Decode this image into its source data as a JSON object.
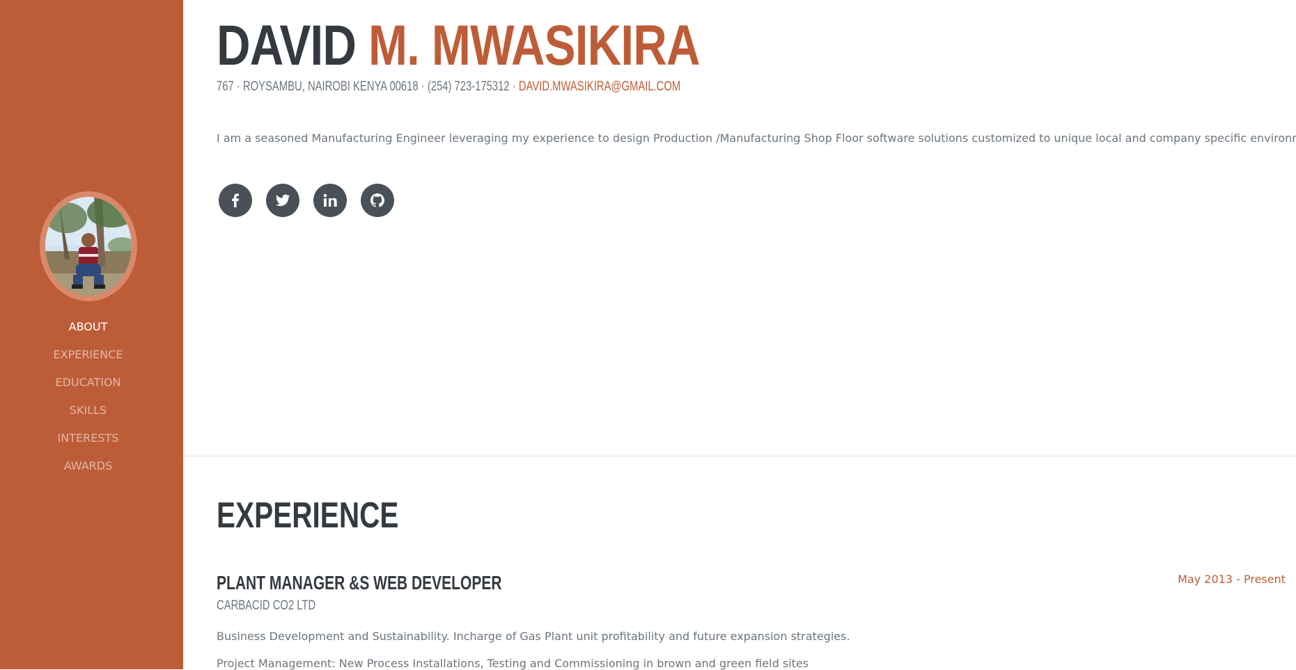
{
  "sidebar": {
    "avatar_alt": "profile photo",
    "nav": [
      {
        "label": "ABOUT",
        "active": true
      },
      {
        "label": "EXPERIENCE",
        "active": false
      },
      {
        "label": "EDUCATION",
        "active": false
      },
      {
        "label": "SKILLS",
        "active": false
      },
      {
        "label": "INTERESTS",
        "active": false
      },
      {
        "label": "AWARDS",
        "active": false
      }
    ]
  },
  "about": {
    "first_name": "DAVID",
    "last_name": "M. MWASIKIRA",
    "contact": "767 · ROYSAMBU, NAIROBI KENYA 00618 · (254) 723-175312 · ",
    "email": "DAVID.MWASIKIRA@GMAIL.COM",
    "lead": "I am a seasoned Manufacturing Engineer leveraging my experience to design Production /Manufacturing Shop Floor software solutions customized to unique local and company specific environments.",
    "socials": [
      {
        "icon": "facebook-icon"
      },
      {
        "icon": "twitter-icon"
      },
      {
        "icon": "linkedin-icon"
      },
      {
        "icon": "github-icon"
      }
    ]
  },
  "experience": {
    "title": "EXPERIENCE",
    "jobs": [
      {
        "title": "PLANT MANAGER &S WEB DEVELOPER",
        "company": "CARBACID CO2 LTD",
        "date": "May 2013 - Present",
        "desc": [
          "Business Development and Sustainability. Incharge of Gas Plant unit profitability and future expansion strategies.",
          "Project Management: New Process Installations, Testing and Commissioning in brown and green field sites"
        ]
      }
    ]
  },
  "colors": {
    "primary": "#bd5d38",
    "dark": "#343a40",
    "muted": "#6c757d",
    "icon_bg": "#495057"
  }
}
